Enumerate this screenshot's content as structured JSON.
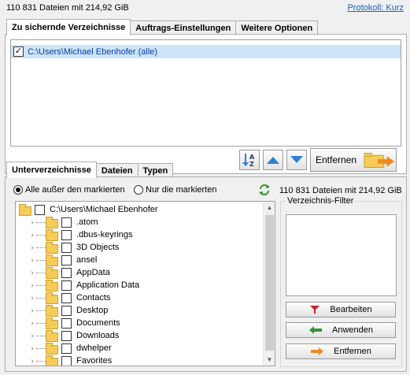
{
  "header": {
    "file_count": "110 831 Dateien mit 214,92 GiB",
    "protokoll_link": "Protokoll: Kurz"
  },
  "tabs_top": [
    "Zu sichernde Verzeichnisse",
    "Auftrags-Einstellungen",
    "Weitere Optionen"
  ],
  "dirlist": {
    "items": [
      {
        "label": "C:\\Users\\Michael Ebenhofer (alle)",
        "checked": true
      }
    ]
  },
  "buttons": {
    "remove": "Entfernen"
  },
  "tabs_bottom": [
    "Unterverzeichnisse",
    "Dateien",
    "Typen"
  ],
  "radio": {
    "all_except": "Alle außer den markierten",
    "only_marked": "Nur die markierten"
  },
  "bottom_count": "110 831 Dateien mit 214,92 GiB",
  "tree": {
    "root": "C:\\Users\\Michael Ebenhofer",
    "items": [
      ".atom",
      ".dbus-keyrings",
      "3D Objects",
      "ansel",
      "AppData",
      "Application Data",
      "Contacts",
      "Desktop",
      "Documents",
      "Downloads",
      "dwhelper",
      "Favorites"
    ]
  },
  "filter": {
    "title": "Verzeichnis-Filter",
    "edit": "Bearbeiten",
    "apply": "Anwenden",
    "remove": "Entfernen"
  },
  "colors": {
    "accent_link": "#1a5fb4",
    "selection": "#cce4f7",
    "folder": "#f5cc57",
    "arrow_blue": "#2f7fd3",
    "arrow_green": "#2e9a2e",
    "arrow_orange": "#f08a1c",
    "funnel_red": "#d42020"
  }
}
